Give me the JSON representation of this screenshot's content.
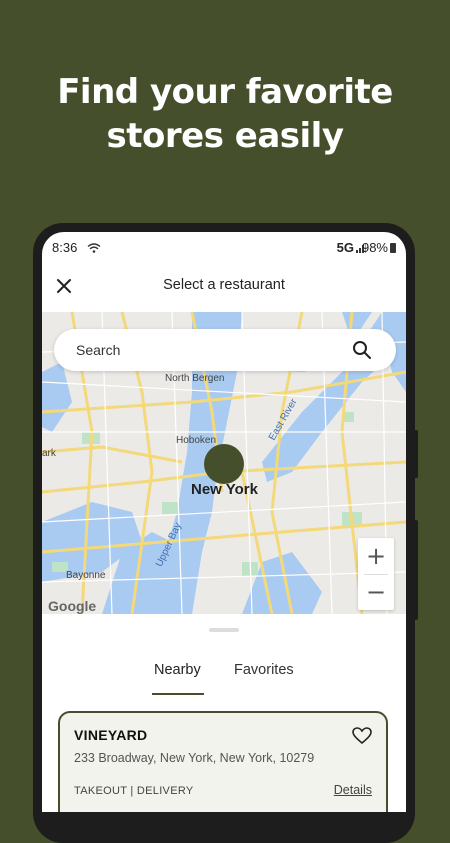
{
  "promo": {
    "headline_line1": "Find your favorite",
    "headline_line2": "stores easily",
    "background_color": "#454f2c"
  },
  "status_bar": {
    "time": "8:36",
    "network": "5G",
    "battery": "98%"
  },
  "header": {
    "title": "Select a restaurant",
    "close_icon": "close-icon"
  },
  "search": {
    "placeholder": "Search",
    "icon": "search-icon"
  },
  "map": {
    "labels": {
      "north_bergen": "North Bergen",
      "hoboken": "Hoboken",
      "new_york": "New York",
      "bayonne": "Bayonne",
      "upper_bay": "Upper Bay",
      "east_river": "East River",
      "park": "ark"
    },
    "attribution": "Google",
    "zoom_in": "+",
    "zoom_out": "−",
    "pin_color": "#454f2c"
  },
  "tabs": [
    {
      "label": "Nearby",
      "active": true
    },
    {
      "label": "Favorites",
      "active": false
    }
  ],
  "restaurant": {
    "name": "VINEYARD",
    "address": "233 Broadway, New York, New York, 10279",
    "services": "TAKEOUT | DELIVERY",
    "details_label": "Details",
    "favorite_icon": "heart-outline-icon"
  }
}
